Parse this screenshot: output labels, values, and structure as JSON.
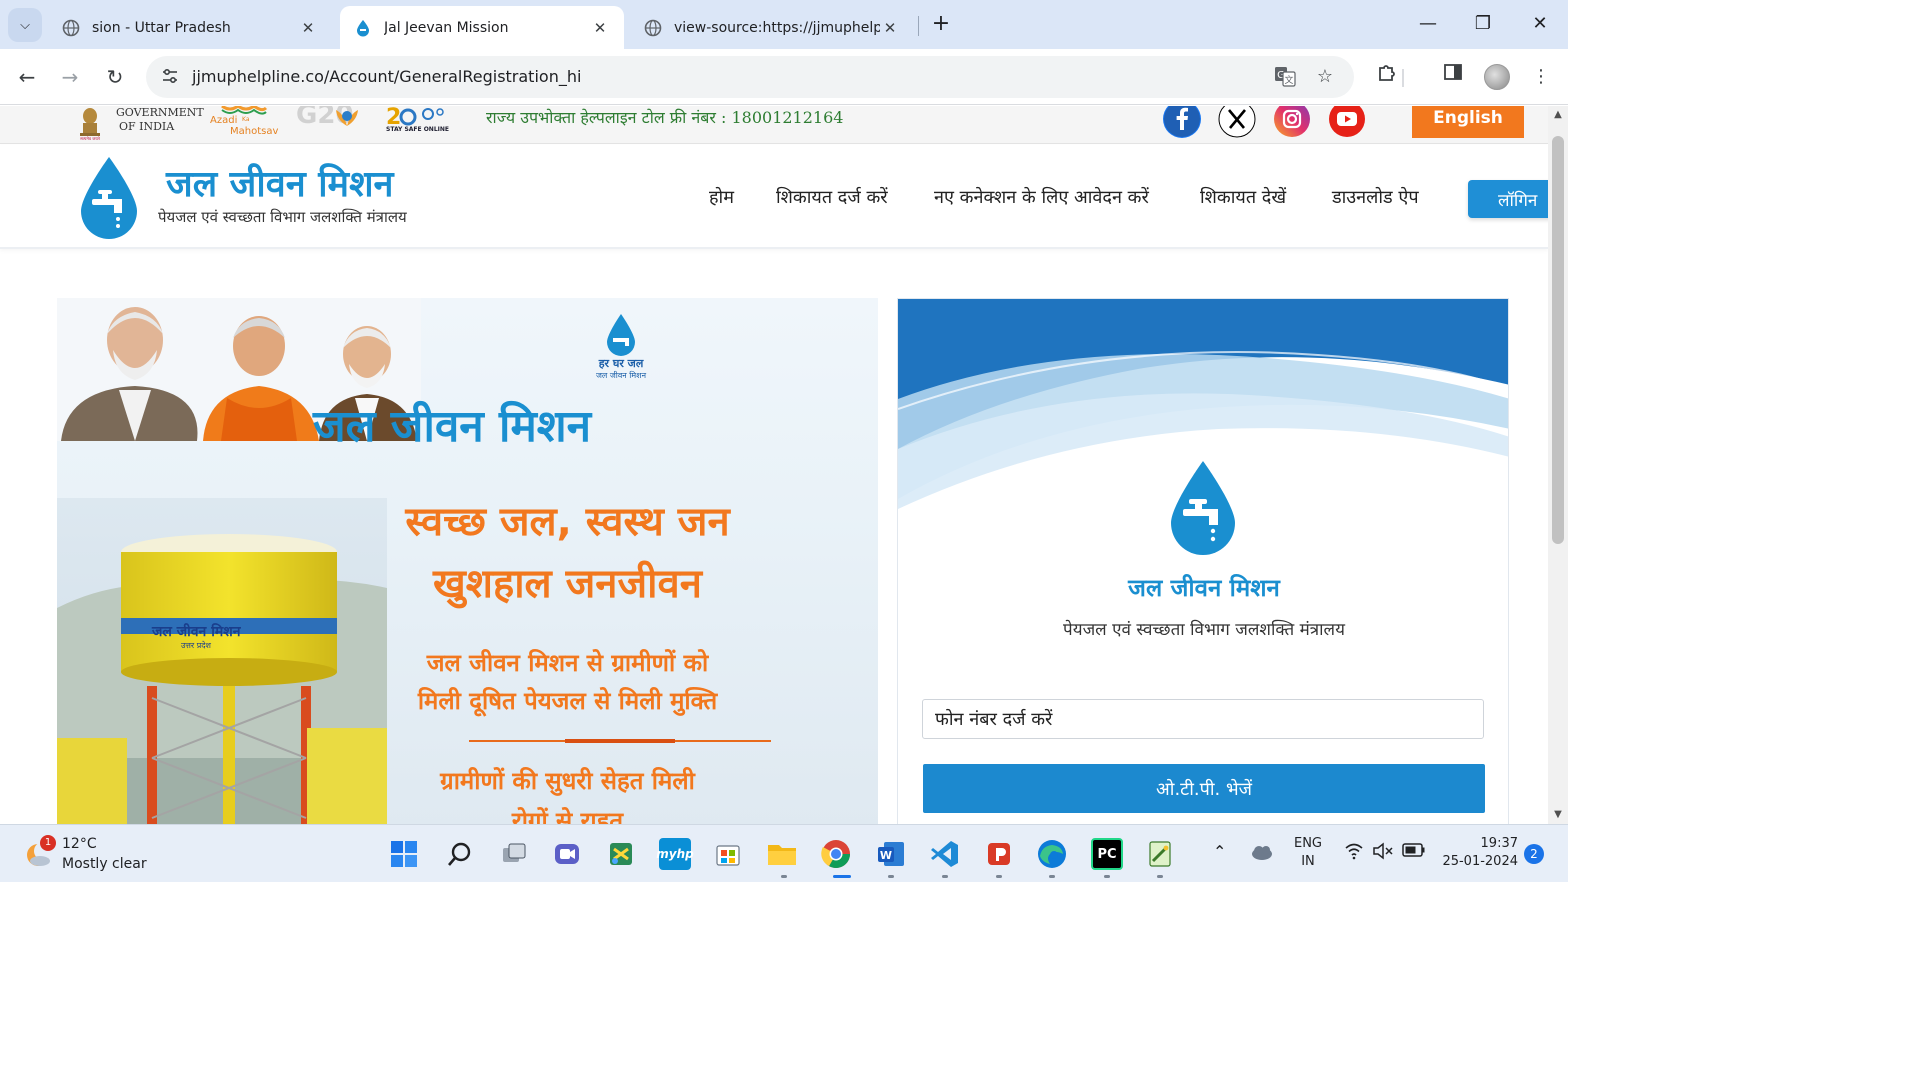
{
  "browser": {
    "tabs": [
      {
        "title": "sion - Uttar Pradesh",
        "active": false
      },
      {
        "title": "Jal Jeevan Mission",
        "active": true
      },
      {
        "title": "view-source:https://jjmuphelpli",
        "active": false
      }
    ],
    "url": "jjmuphelpline.co/Account/GeneralRegistration_hi",
    "icons": {
      "tab_list": "chevron-down-icon",
      "new_tab": "plus-icon",
      "minimize": "minimize-icon",
      "restore": "restore-icon",
      "close": "close-icon",
      "back": "back-arrow-icon",
      "forward": "forward-arrow-icon",
      "reload": "reload-icon",
      "site_info": "tune-icon",
      "translate": "translate-icon",
      "bookmark": "star-icon",
      "extensions": "puzzle-icon",
      "side_panel": "side-panel-icon",
      "menu": "kebab-menu-icon"
    }
  },
  "page": {
    "top_strip": {
      "goi_line1": "GOVERNMENT",
      "goi_line2": "OF INDIA",
      "azadi_line1": "Azadi",
      "azadi_line2": "Ka",
      "azadi_line3": "Mahotsav",
      "g20_text": "G20",
      "stay_safe_text": "STAY SAFE ONLINE",
      "helpline": "राज्य उपभोक्ता हेल्पलाइन टोल फ्री नंबर : 18001212164",
      "social": [
        "facebook",
        "x",
        "instagram",
        "youtube"
      ],
      "language_button": "English"
    },
    "header": {
      "brand_title": "जल जीवन मिशन",
      "brand_subtitle": "पेयजल एवं स्वच्छता विभाग जलशक्ति मंत्रालय",
      "nav": [
        "होम",
        "शिकायत दर्ज करें",
        "नए कनेक्शन के लिए आवेदन करें",
        "शिकायत देखें",
        "डाउनलोड ऐप"
      ],
      "login_button": "लॉगिन"
    },
    "banner": {
      "logo_line1": "हर घर जल",
      "logo_line2": "जल जीवन मिशन",
      "title": "जल जीवन मिशन",
      "slogan_line1": "स्वच्छ जल, स्वस्थ जन",
      "slogan_line2": "खुशहाल जनजीवन",
      "message_line1": "जल जीवन मिशन से ग्रामीणों को",
      "message_line2": "मिली दूषित पेयजल से मिली मुक्ति",
      "footer_line1": "ग्रामीणों की सुधरी सेहत मिली",
      "footer_line2": "रोगों से राहत",
      "tower_label_line1": "जल जीवन मिशन",
      "tower_label_line2": "उत्तर प्रदेश"
    },
    "login_card": {
      "title": "जल जीवन मिशन",
      "subtitle": "पेयजल एवं स्वच्छता विभाग जलशक्ति मंत्रालय",
      "phone_placeholder": "फोन नंबर दर्ज करें",
      "otp_button": "ओ.टी.पी. भेजें"
    },
    "colors": {
      "brand_blue": "#1a8fd0",
      "accent_orange": "#f2781e",
      "helpline_green": "#2e7d32",
      "button_blue": "#1c89cf"
    }
  },
  "taskbar": {
    "weather_temp": "12°C",
    "weather_desc": "Mostly clear",
    "weather_badge": "1",
    "language_line1": "ENG",
    "language_line2": "IN",
    "time": "19:37",
    "date": "25-01-2024",
    "notifications": "2",
    "apps": [
      "start",
      "search",
      "task-view",
      "teams",
      "snipping",
      "myhp",
      "store",
      "file-explorer",
      "chrome",
      "word",
      "vscode",
      "powerpoint",
      "edge",
      "pycharm",
      "notepad-plus"
    ]
  }
}
